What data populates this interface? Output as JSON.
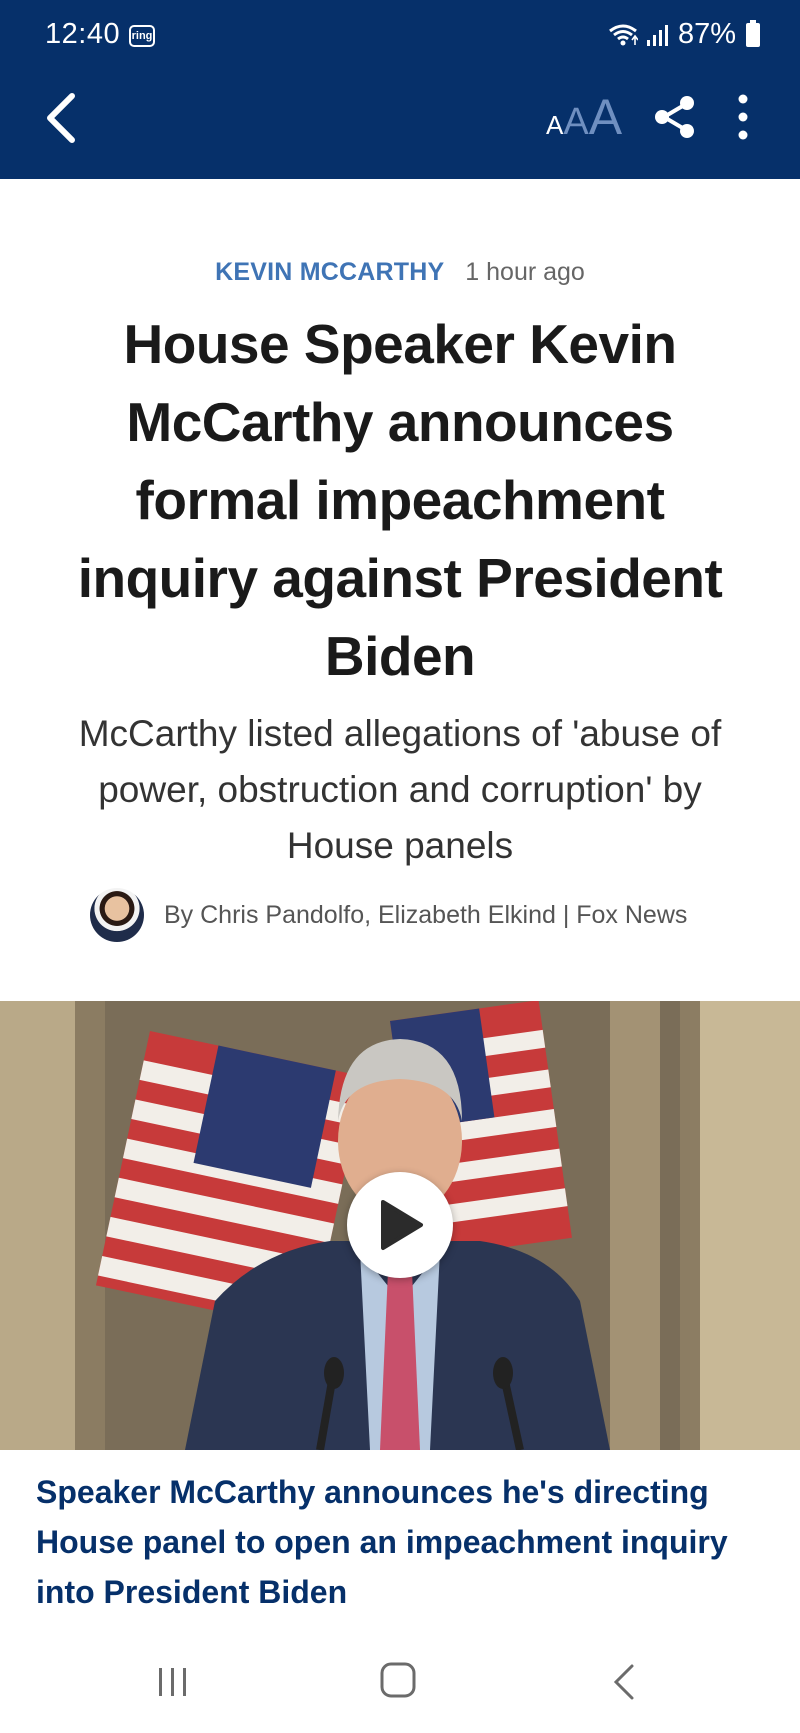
{
  "status_bar": {
    "time": "12:40",
    "ring_badge": "ring",
    "battery": "87%",
    "icons": [
      "wifi-icon",
      "signal-icon",
      "battery-icon"
    ]
  },
  "app_bar": {
    "font_size_glyphs": [
      "A",
      "A",
      "A"
    ],
    "icons": [
      "back-arrow-icon",
      "font-size-icon",
      "share-icon",
      "more-vertical-icon"
    ],
    "colors": {
      "background": "#06306a",
      "accent_muted": "#6f8fc0"
    }
  },
  "article": {
    "category": "KEVIN MCCARTHY",
    "time_ago": "1 hour ago",
    "headline": "House Speaker Kevin McCarthy announces formal impeachment inquiry against President Biden",
    "subheadline": "McCarthy listed allegations of 'abuse of power, obstruction and corruption' by House panels",
    "byline": "By Chris Pandolfo, Elizabeth Elkind | Fox News",
    "colors": {
      "category": "#3f74b5",
      "headline": "#1a1a1a"
    }
  },
  "video": {
    "caption": "Speaker McCarthy announces he's directing House panel to open an impeachment inquiry into President Biden",
    "icon": "play-icon"
  },
  "nav_bar": {
    "icons": [
      "recent-apps-icon",
      "home-icon",
      "back-icon"
    ]
  }
}
